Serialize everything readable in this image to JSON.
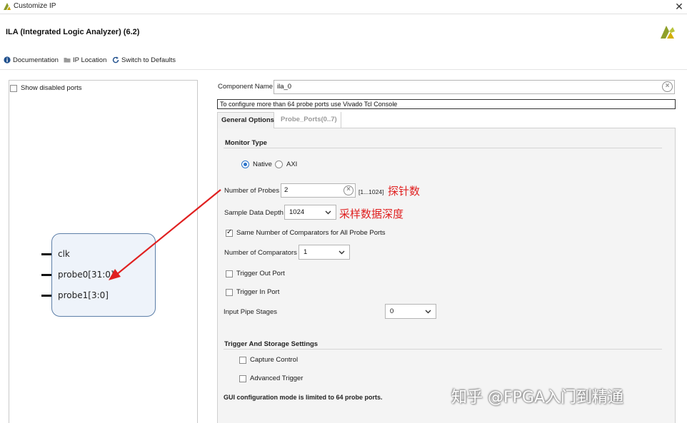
{
  "window": {
    "title": "Customize IP",
    "close_glyph": "✕"
  },
  "header": {
    "title": "ILA (Integrated Logic Analyzer) (6.2)",
    "logo_icon": "vivado-logo-icon"
  },
  "toolbar": {
    "documentation": "Documentation",
    "ip_location": "IP Location",
    "switch_defaults": "Switch to Defaults"
  },
  "left_panel": {
    "show_disabled_ports": "Show disabled ports",
    "show_disabled_checked": false,
    "block": {
      "pins": [
        "clk",
        "probe0[31:0]",
        "probe1[3:0]"
      ]
    }
  },
  "component": {
    "label": "Component Name",
    "value": "ila_0",
    "info": "To configure more than 64 probe ports use Vivado Tcl Console"
  },
  "tabs": [
    {
      "label": "General Options",
      "active": true
    },
    {
      "label": "Probe_Ports(0..7)",
      "active": false
    }
  ],
  "general": {
    "monitor_type": {
      "title": "Monitor Type",
      "options": [
        "Native",
        "AXI"
      ],
      "selected": "Native"
    },
    "num_probes": {
      "label": "Number of Probes",
      "value": "2",
      "range": "[1...1024]"
    },
    "sample_depth": {
      "label": "Sample Data Depth",
      "value": "1024"
    },
    "same_comparators": {
      "label": "Same Number of Comparators for All Probe Ports",
      "checked": true
    },
    "num_comparators": {
      "label": "Number of Comparators",
      "value": "1"
    },
    "trigger_out": {
      "label": "Trigger Out Port",
      "checked": false
    },
    "trigger_in": {
      "label": "Trigger In Port",
      "checked": false
    },
    "input_pipe": {
      "label": "Input Pipe Stages",
      "value": "0"
    },
    "trigger_storage": {
      "title": "Trigger And Storage Settings",
      "capture_control": {
        "label": "Capture Control",
        "checked": false
      },
      "advanced_trigger": {
        "label": "Advanced Trigger",
        "checked": false
      }
    },
    "footer_note": "GUI configuration mode is limited to 64 probe ports."
  },
  "annotations": {
    "probes_note": "探针数",
    "depth_note": "采样数据深度",
    "arrow_color": "#e02020"
  },
  "watermark": "知乎 @FPGA入门到精通"
}
